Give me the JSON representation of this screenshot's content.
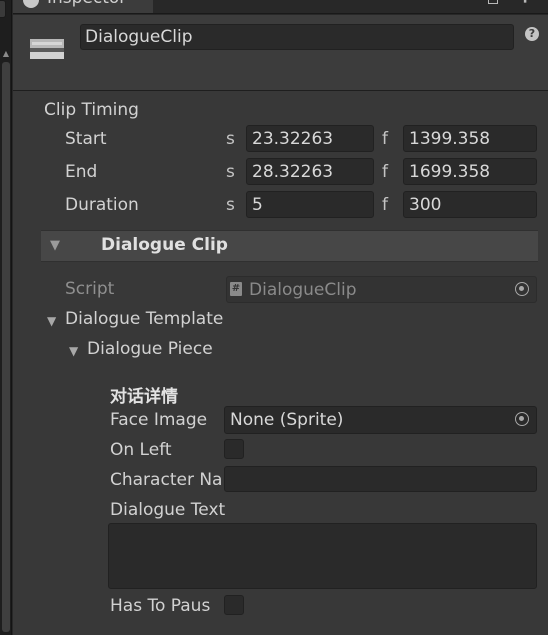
{
  "window": {
    "tab_title": "Inspector"
  },
  "header": {
    "object_name": "DialogueClip",
    "help_glyph": "?"
  },
  "clip_timing": {
    "title": "Clip Timing",
    "seconds_unit": "s",
    "frames_unit": "f",
    "rows": [
      {
        "label": "Start",
        "seconds": "23.32263",
        "frames": "1399.358"
      },
      {
        "label": "End",
        "seconds": "28.32263",
        "frames": "1699.358"
      },
      {
        "label": "Duration",
        "seconds": "5",
        "frames": "300"
      }
    ]
  },
  "dialogue_clip_section": {
    "title": "Dialogue Clip",
    "script_label": "Script",
    "script_value": "DialogueClip",
    "template_label": "Dialogue Template",
    "piece_label": "Dialogue Piece",
    "group_header": "对话详情",
    "face_image_label": "Face Image",
    "face_image_value": "None (Sprite)",
    "on_left_label": "On Left",
    "on_left_checked": false,
    "character_name_label": "Character Na",
    "character_name_value": "",
    "dialogue_text_label": "Dialogue Text",
    "dialogue_text_value": "",
    "has_to_pause_label": "Has To Paus",
    "has_to_pause_checked": false
  },
  "icons": [
    "inspector-icon",
    "maximize-icon",
    "more-menu-icon",
    "timeline-clip-icon",
    "help-icon",
    "foldout-arrow-icon",
    "script-file-icon",
    "object-picker-icon"
  ],
  "colors": {
    "panel_bg": "#383838",
    "field_bg": "#2a2a2a",
    "section_bg": "#474747",
    "tab_accent": "#3a7bd5"
  }
}
